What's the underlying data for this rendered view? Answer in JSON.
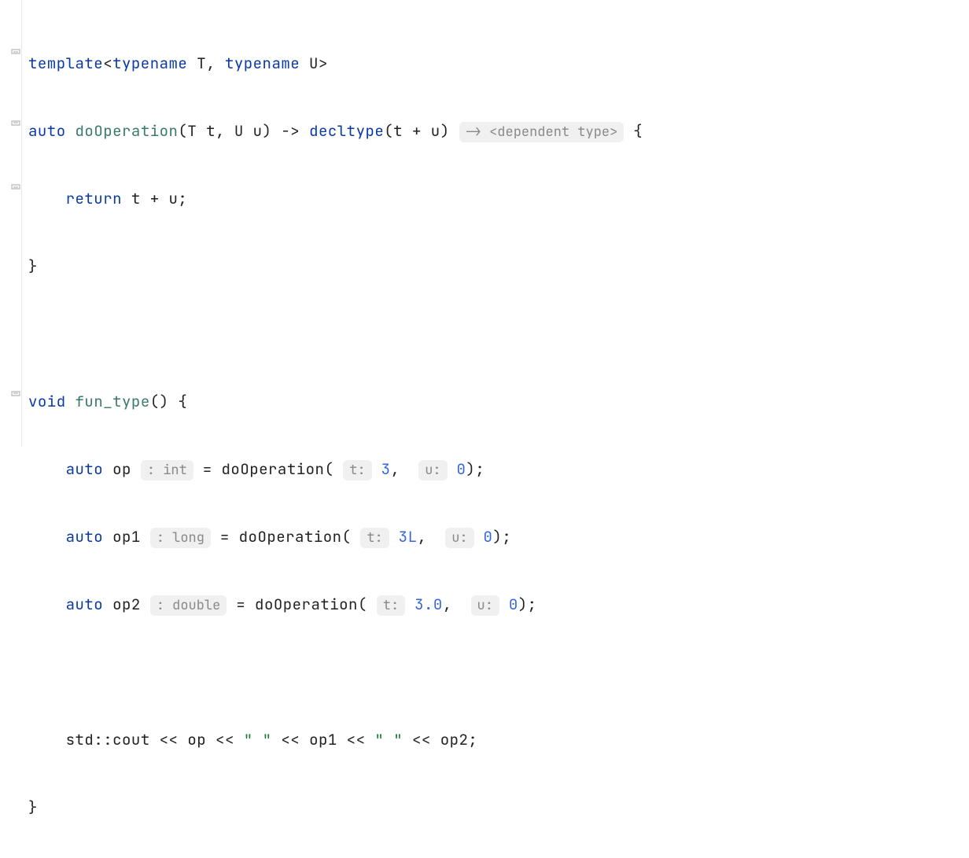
{
  "code": {
    "line1": {
      "template": "template",
      "lt": "<",
      "typename1": "typename",
      "T": "T",
      "comma": ",",
      "typename2": "typename",
      "U": "U",
      "gt": ">"
    },
    "line2": {
      "auto": "auto",
      "fn": "doOperation",
      "lp": "(",
      "Tt": "T t",
      "comma": ",",
      "Uu": " U u",
      "rp": ")",
      "arrow": " -> ",
      "decltype": "decltype",
      "lb": "(",
      "expr": "t + u",
      "rb": ")",
      "hint": "-> <dependent type>",
      "brace": " {"
    },
    "line3": {
      "return": "return",
      "expr": " t + u",
      "semi": ";"
    },
    "line4": {
      "brace": "}"
    },
    "line6": {
      "void": "void",
      "fn": "fun_type",
      "parens": "()",
      "brace": " {"
    },
    "line7": {
      "auto": "auto",
      "var": " op",
      "hint": ": int",
      "eq": " = ",
      "call": "doOperation",
      "lp": "(",
      "pn1": "t:",
      "arg1": "3",
      "comma": ",",
      "pn2": "u:",
      "arg2": "0",
      "rp": ")",
      "semi": ";"
    },
    "line8": {
      "auto": "auto",
      "var": " op1",
      "hint": ": long",
      "eq": " = ",
      "call": "doOperation",
      "lp": "(",
      "pn1": "t:",
      "arg1": "3L",
      "comma": ",",
      "pn2": "u:",
      "arg2": "0",
      "rp": ")",
      "semi": ";"
    },
    "line9": {
      "auto": "auto",
      "var": " op2",
      "hint": ": double",
      "eq": " = ",
      "call": "doOperation",
      "lp": "(",
      "pn1": "t:",
      "arg1": "3.0",
      "comma": ",",
      "pn2": "u:",
      "arg2": "0",
      "rp": ")",
      "semi": ";"
    },
    "line11": {
      "std": "std",
      "scope": "::",
      "cout": "cout",
      "ins1": " << ",
      "v1": "op",
      "ins2": " << ",
      "s1": "\" \"",
      "ins3": " << ",
      "v2": "op1",
      "ins4": " << ",
      "s2": "\" \"",
      "ins5": " << ",
      "v3": "op2",
      "semi": ";"
    },
    "line12": {
      "brace": "}"
    }
  },
  "gutter": {
    "fold_open": "fold-open",
    "fold_close": "fold-close"
  }
}
